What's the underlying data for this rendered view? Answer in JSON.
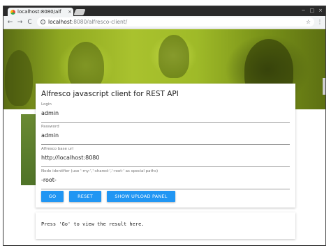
{
  "browser": {
    "tab_title": "localhost:8080/alf",
    "tab_close": "×",
    "url_host": "localhost",
    "url_path": ":8080/alfresco-client/",
    "window_controls": [
      "−",
      "□",
      "×"
    ],
    "nav": {
      "back": "←",
      "forward": "→",
      "reload": "C"
    },
    "star": "☆",
    "menu": "⋮"
  },
  "form": {
    "title": "Alfresco javascript client for REST API",
    "login": {
      "label": "Login",
      "value": "admin"
    },
    "password": {
      "label": "Password",
      "value": "admin"
    },
    "base_url": {
      "label": "Alfresco base url",
      "value": "http://localhost:8080"
    },
    "node_id": {
      "label": "Node identifier (use '-my-','-shared-','-root-' as special paths)",
      "value": "-root-"
    },
    "buttons": {
      "go": "GO",
      "reset": "RESET",
      "upload": "SHOW UPLOAD PANEL"
    }
  },
  "result": {
    "text": "Press 'Go' to view the result here."
  },
  "colors": {
    "accent": "#2196f3",
    "hero_green": "#a9c22e"
  }
}
